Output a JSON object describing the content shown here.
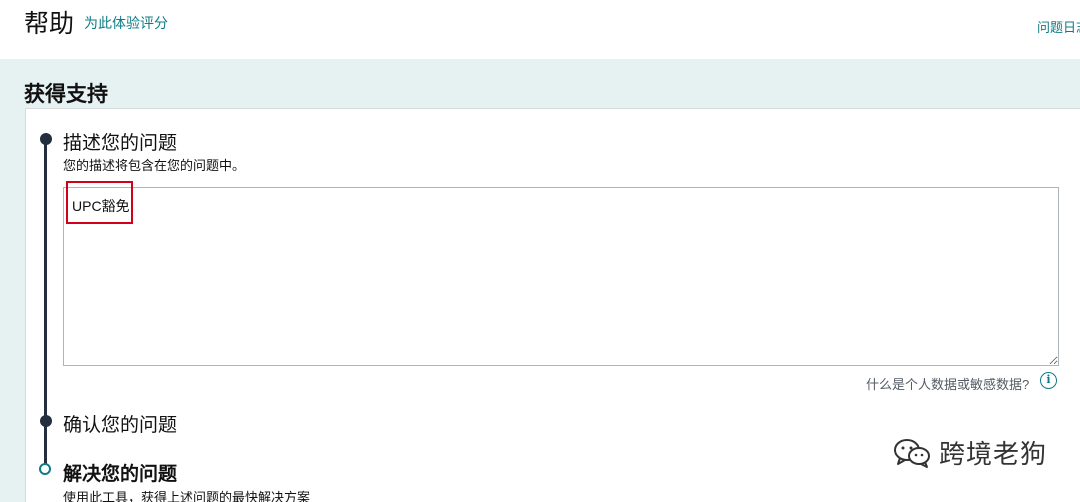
{
  "header": {
    "title": "帮助",
    "rate_link": "为此体验评分",
    "log_link": "问题日志"
  },
  "support": {
    "title": "获得支持"
  },
  "steps": [
    {
      "title": "描述您的问题",
      "subtitle": "您的描述将包含在您的问题中。",
      "state": "complete"
    },
    {
      "title": "确认您的问题",
      "state": "complete"
    },
    {
      "title": "解决您的问题",
      "subtitle": "使用此工具，获得上述问题的最快解决方案",
      "state": "current"
    }
  ],
  "description_field": {
    "value": "UPC豁免"
  },
  "sensitive_data": {
    "label": "什么是个人数据或敏感数据?",
    "icon": "info-icon"
  },
  "watermark": {
    "text": "跨境老狗",
    "icon": "wechat-icon"
  },
  "colors": {
    "accent": "#0e7c86",
    "band": "#e6f1f1",
    "step_line": "#232f3e",
    "highlight": "#d0021b"
  }
}
